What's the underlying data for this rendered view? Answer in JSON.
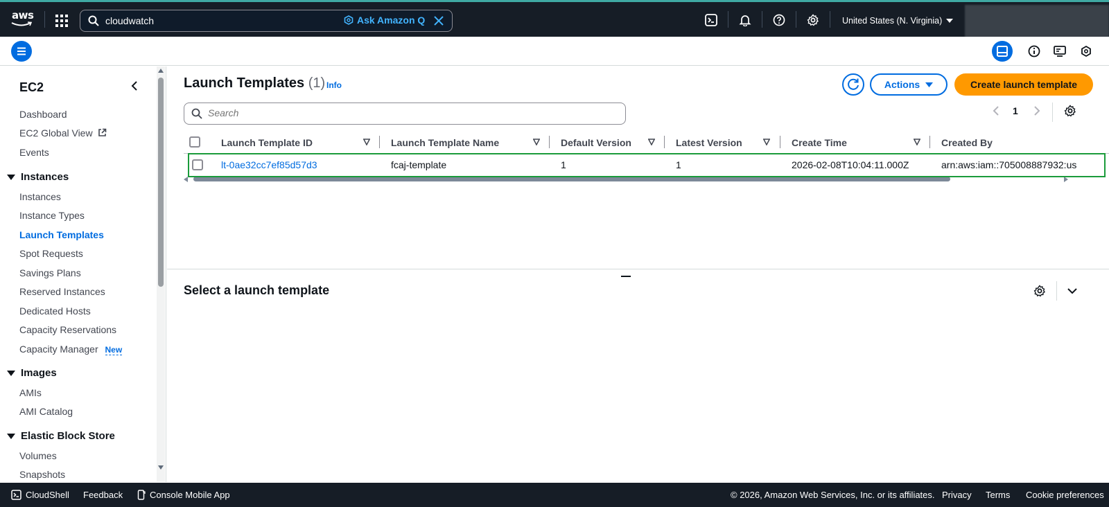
{
  "topbar": {
    "logo_text": "aws",
    "search_value": "cloudwatch",
    "ask_q_label": "Ask Amazon Q",
    "region_label": "United States (N. Virginia)",
    "icons": [
      "cloudshell-icon",
      "bell-icon",
      "help-icon",
      "gear-icon"
    ]
  },
  "sidebar": {
    "title": "EC2",
    "top_items": [
      {
        "label": "Dashboard"
      },
      {
        "label": "EC2 Global View"
      },
      {
        "label": "Events"
      }
    ],
    "sections": [
      {
        "title": "Instances",
        "items": [
          "Instances",
          "Instance Types",
          "Launch Templates",
          "Spot Requests",
          "Savings Plans",
          "Reserved Instances",
          "Dedicated Hosts",
          "Capacity Reservations",
          "Capacity Manager"
        ]
      },
      {
        "title": "Images",
        "items": [
          "AMIs",
          "AMI Catalog"
        ]
      },
      {
        "title": "Elastic Block Store",
        "items": [
          "Volumes",
          "Snapshots"
        ]
      }
    ],
    "new_badge": "New",
    "active_item": "Launch Templates"
  },
  "main": {
    "title": "Launch Templates",
    "count": "(1)",
    "info_label": "Info",
    "actions_label": "Actions",
    "create_label": "Create launch template",
    "search_placeholder": "Search",
    "page_number": "1",
    "columns": [
      "Launch Template ID",
      "Launch Template Name",
      "Default Version",
      "Latest Version",
      "Create Time",
      "Created By"
    ],
    "rows": [
      {
        "id": "lt-0ae32cc7ef85d57d3",
        "name": "fcaj-template",
        "default_version": "1",
        "latest_version": "1",
        "create_time": "2026-02-08T10:04:11.000Z",
        "created_by": "arn:aws:iam::705008887932:us"
      }
    ],
    "panel_title": "Select a launch template"
  },
  "footer": {
    "cloudshell": "CloudShell",
    "feedback": "Feedback",
    "mobile_app": "Console Mobile App",
    "copyright": "© 2026, Amazon Web Services, Inc. or its affiliates.",
    "privacy": "Privacy",
    "terms": "Terms",
    "cookies": "Cookie preferences"
  },
  "colors": {
    "nav_bg": "#161d26",
    "link": "#006ce0",
    "primary_button": "#ff9900",
    "highlight_border": "#1a9b3a"
  }
}
